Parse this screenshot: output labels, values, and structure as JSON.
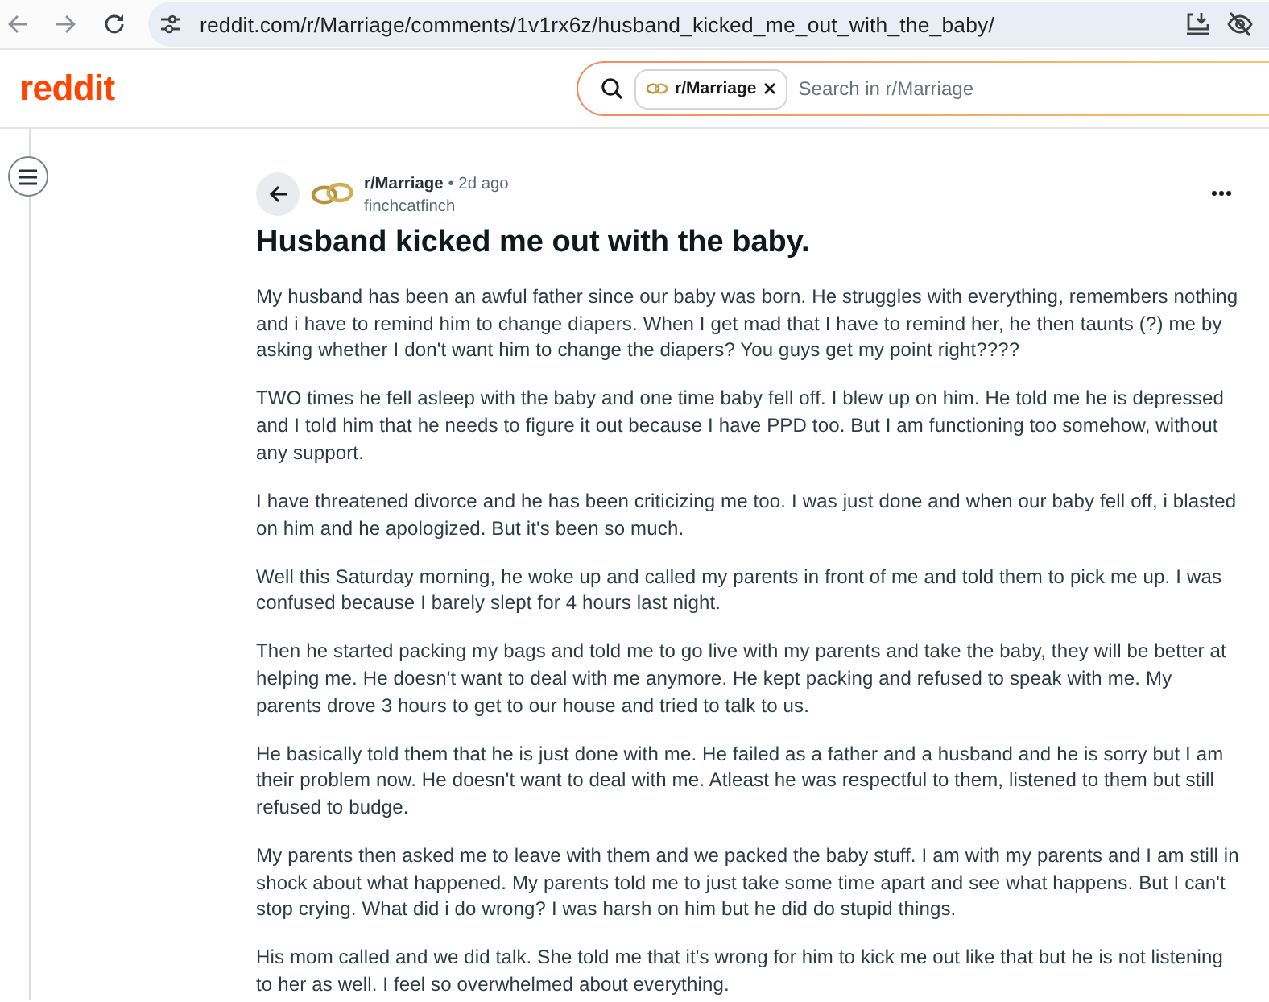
{
  "browser": {
    "url": "reddit.com/r/Marriage/comments/1v1rx6z/husband_kicked_me_out_with_the_baby/"
  },
  "header": {
    "logo": "reddit",
    "search": {
      "chip": "r/Marriage",
      "placeholder": "Search in r/Marriage"
    }
  },
  "post": {
    "subreddit": "r/Marriage",
    "time": "• 2d ago",
    "author": "finchcatfinch",
    "title": "Husband kicked me out with the baby.",
    "paragraphs": [
      "My husband has been an awful father since our baby was born. He struggles with everything, remembers nothing and i have to remind him to change diapers. When I get mad that I have to remind her, he then taunts (?) me by asking whether I don't want him to change the diapers? You guys get my point right????",
      "TWO times he fell asleep with the baby and one time baby fell off. I blew up on him. He told me he is depressed and I told him that he needs to figure it out because I have PPD too. But I am functioning too somehow, without any support.",
      "I have threatened divorce and he has been criticizing me too. I was just done and when our baby fell off, i blasted on him and he apologized. But it's been so much.",
      "Well this Saturday morning, he woke up and called my parents in front of me and told them to pick me up. I was confused because I barely slept for 4 hours last night.",
      "Then he started packing my bags and told me to go live with my parents and take the baby, they will be better at helping me. He doesn't want to deal with me anymore. He kept packing and refused to speak with me. My parents drove 3 hours to get to our house and tried to talk to us.",
      "He basically told them that he is just done with me. He failed as a father and a husband and he is sorry but I am their problem now. He doesn't want to deal with me. Atleast he was respectful to them, listened to them but still refused to budge.",
      "My parents then asked me to leave with them and we packed the baby stuff. I am with my parents and I am still in shock about what happened. My parents told me to just take some time apart and see what happens. But I can't stop crying. What did i do wrong? I was harsh on him but he did do stupid things.",
      "His mom called and we did talk. She told me that it's wrong for him to kick me out like that but he is not listening to her as well. I feel so overwhelmed about everything."
    ]
  }
}
